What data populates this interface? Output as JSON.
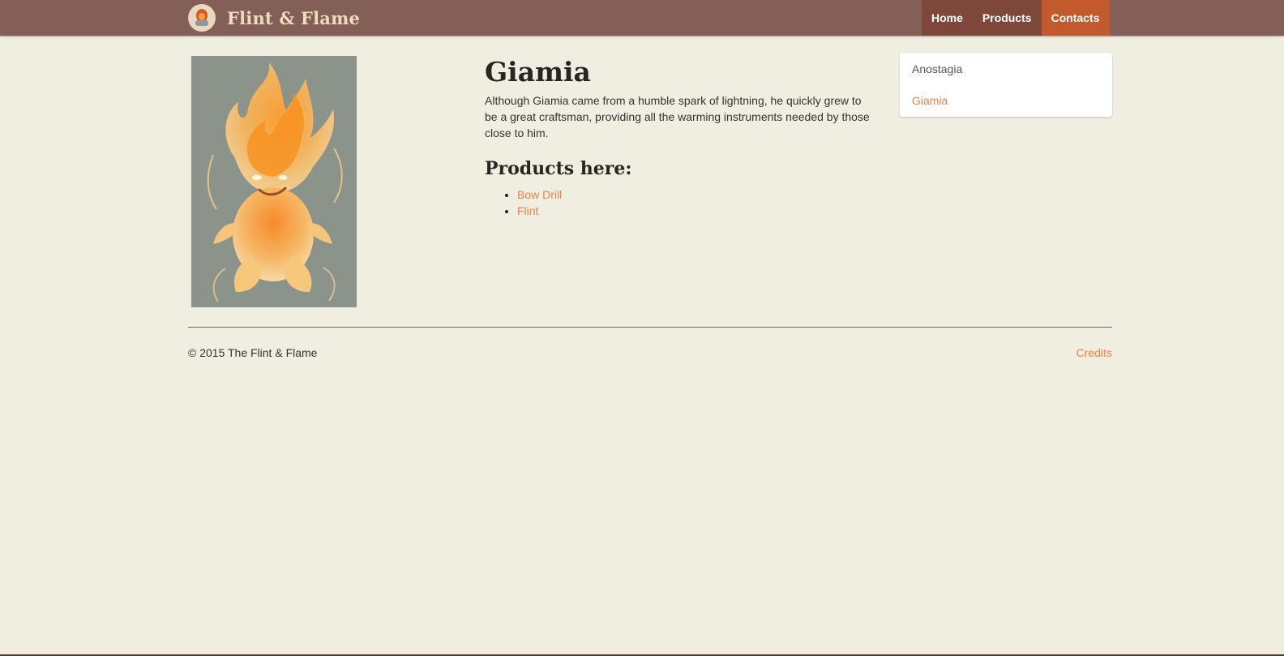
{
  "brand": {
    "name": "Flint & Flame",
    "logo_icon": "flame-logo-icon"
  },
  "nav": {
    "items": [
      "Home",
      "Products",
      "Contacts"
    ],
    "active": "Contacts"
  },
  "portrait": {
    "icon": "fire-sprite-illustration"
  },
  "main": {
    "title": "Giamia",
    "description": "Although Giamia came from a humble spark of lightning, he quickly grew to be a great craftsman, providing all the warming instruments needed by those close to him.",
    "products_heading": "Products here:",
    "products": [
      "Bow Drill",
      "Flint"
    ]
  },
  "sidebar": {
    "items": [
      "Anostagia",
      "Giamia"
    ],
    "active": "Giamia"
  },
  "footer": {
    "copyright": "© 2015 The Flint & Flame",
    "credits": "Credits"
  },
  "colors": {
    "navbar": "#845f57",
    "active_nav": "#c35a2e",
    "background": "#f0ede1",
    "link": "#e8824a"
  }
}
